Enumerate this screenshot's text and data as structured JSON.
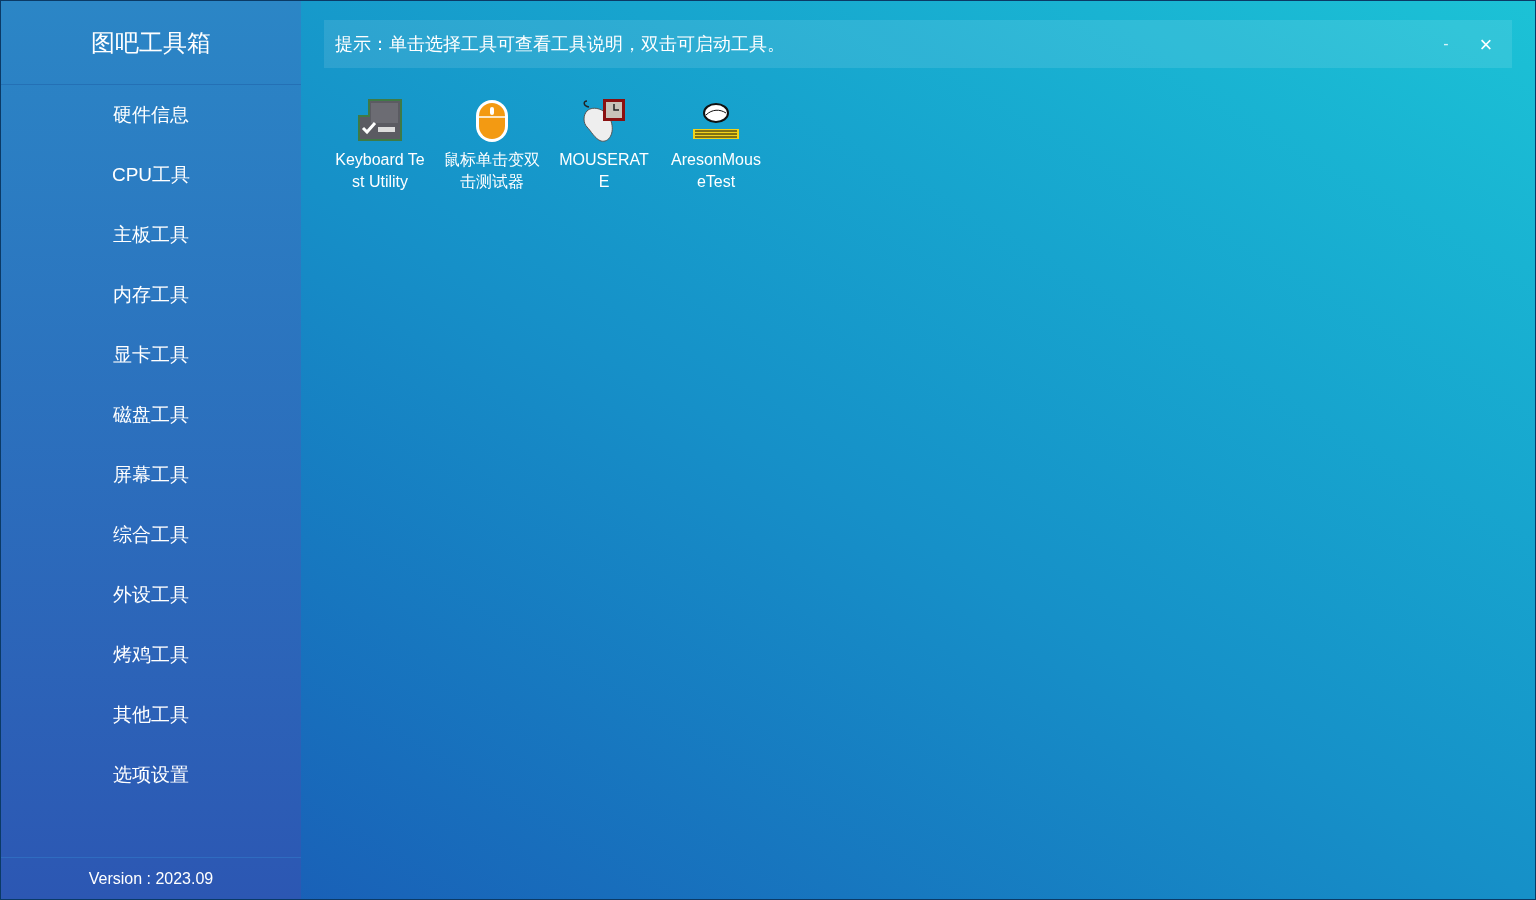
{
  "sidebar": {
    "title": "图吧工具箱",
    "items": [
      {
        "label": "硬件信息"
      },
      {
        "label": "CPU工具"
      },
      {
        "label": "主板工具"
      },
      {
        "label": "内存工具"
      },
      {
        "label": "显卡工具"
      },
      {
        "label": "磁盘工具"
      },
      {
        "label": "屏幕工具"
      },
      {
        "label": "综合工具"
      },
      {
        "label": "外设工具"
      },
      {
        "label": "烤鸡工具"
      },
      {
        "label": "其他工具"
      },
      {
        "label": "选项设置"
      }
    ],
    "version": "Version : 2023.09"
  },
  "hint_bar": {
    "text": "提示：单击选择工具可查看工具说明，双击可启动工具。",
    "minimize": "-",
    "close": "×"
  },
  "tools": [
    {
      "kind": "keyboard",
      "label": "Keyboard Test Utility"
    },
    {
      "kind": "orange-mouse",
      "label": "鼠标单击变双击测试器"
    },
    {
      "kind": "clock-mouse",
      "label": "MOUSERATE"
    },
    {
      "kind": "areson",
      "label": "AresonMouseTest"
    }
  ]
}
